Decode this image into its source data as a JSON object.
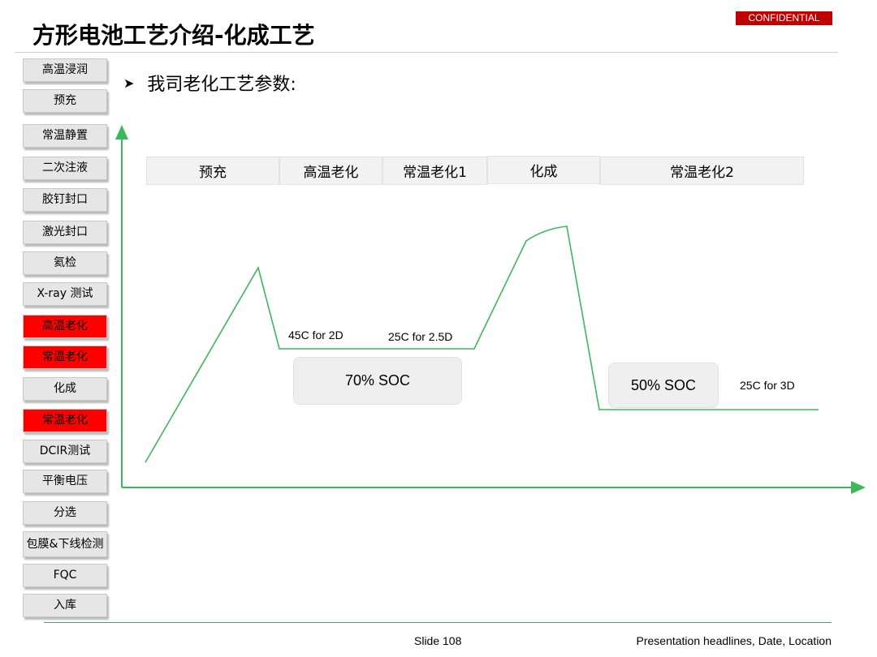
{
  "header": {
    "title": "方形电池工艺介绍-化成工艺",
    "badge": "CONFIDENTIAL"
  },
  "process_steps": [
    {
      "label": "高温浸润",
      "highlighted": false
    },
    {
      "label": "预充",
      "highlighted": false
    },
    {
      "label": "常温静置",
      "highlighted": false
    },
    {
      "label": "二次注液",
      "highlighted": false
    },
    {
      "label": "胶钉封口",
      "highlighted": false
    },
    {
      "label": "激光封口",
      "highlighted": false
    },
    {
      "label": "氦检",
      "highlighted": false
    },
    {
      "label": "X-ray 测试",
      "highlighted": false
    },
    {
      "label": "高温老化",
      "highlighted": true
    },
    {
      "label": "常温老化",
      "highlighted": true
    },
    {
      "label": "化成",
      "highlighted": false
    },
    {
      "label": "常温老化",
      "highlighted": true
    },
    {
      "label": "DCIR测试",
      "highlighted": false
    },
    {
      "label": "平衡电压",
      "highlighted": false
    },
    {
      "label": "分选",
      "highlighted": false
    },
    {
      "label": "包膜&下线检测",
      "highlighted": false
    },
    {
      "label": "FQC",
      "highlighted": false
    },
    {
      "label": "入库",
      "highlighted": false
    }
  ],
  "section_heading": "我司老化工艺参数:",
  "phases": [
    "预充",
    "高温老化",
    "常温老化1",
    "化成",
    "常温老化2"
  ],
  "annotations": {
    "high_temp_aging": "45C for 2D",
    "room_temp_aging_1": "25C for 2.5D",
    "room_temp_aging_2": "25C for 3D"
  },
  "soc_labels": {
    "aging": "70% SOC",
    "after_formation": "50% SOC"
  },
  "colors": {
    "curve": "#3cb85c",
    "highlight": "#ff0000",
    "badge": "#c00000"
  },
  "footer": {
    "slide": "Slide 108",
    "text": "Presentation headlines, Date, Location"
  }
}
